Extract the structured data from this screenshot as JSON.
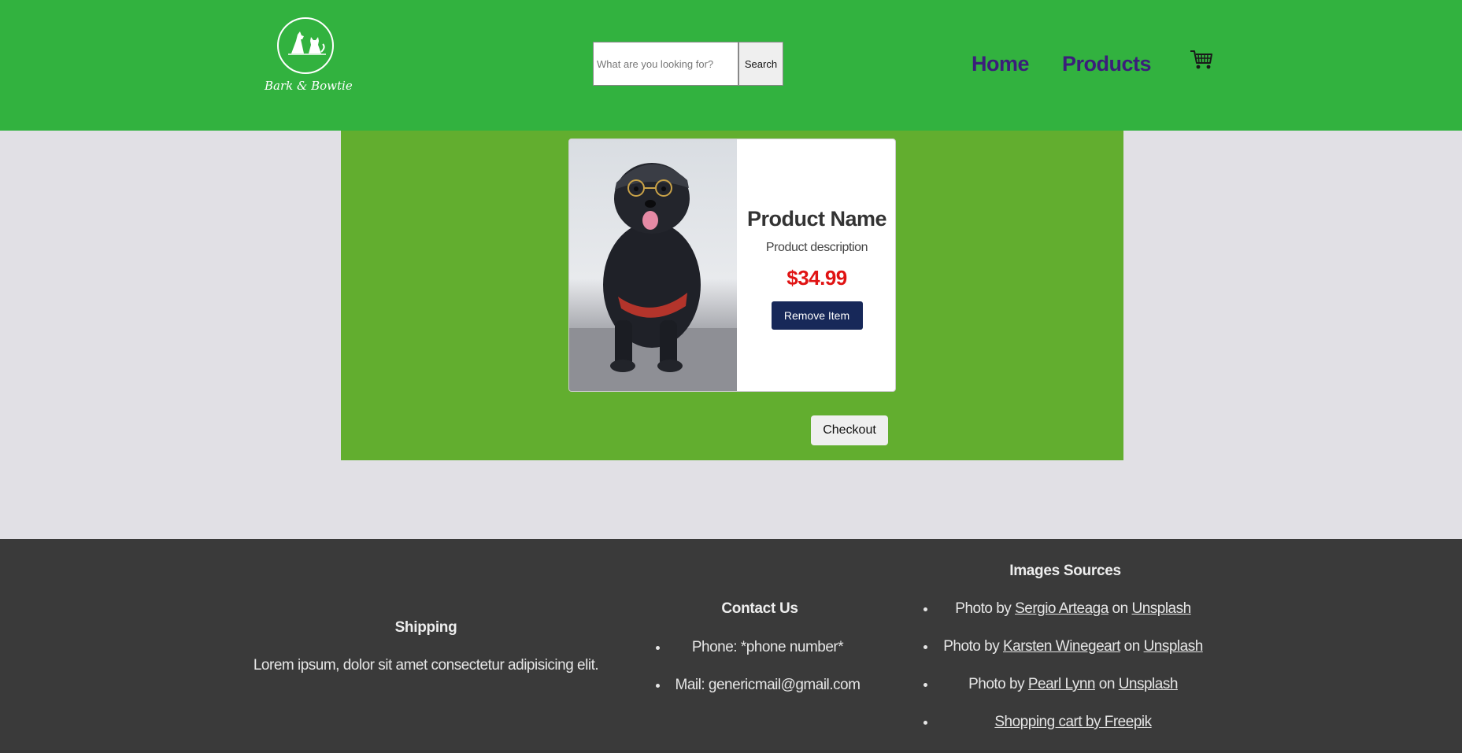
{
  "header": {
    "logo_text": "Bark & Bowtie",
    "search_placeholder": "What are you looking for?",
    "search_button": "Search",
    "nav": [
      {
        "label": "Home"
      },
      {
        "label": "Products"
      }
    ],
    "cart_icon": "shopping-cart-icon"
  },
  "cart": {
    "items": [
      {
        "name": "Product Name",
        "description": "Product description",
        "price": "$34.99",
        "remove_label": "Remove Item",
        "image": "black dog wearing cap and glasses"
      }
    ],
    "checkout_label": "Checkout"
  },
  "footer": {
    "shipping": {
      "title": "Shipping",
      "text": "Lorem ipsum, dolor sit amet consectetur adipisicing elit."
    },
    "contact": {
      "title": "Contact Us",
      "items": [
        "Phone: *phone number*",
        "Mail: genericmail@gmail.com"
      ]
    },
    "images": {
      "title": "Images Sources",
      "credits": [
        {
          "prefix": "Photo by ",
          "author": "Sergio Arteaga",
          "mid": " on ",
          "site": "Unsplash"
        },
        {
          "prefix": "Photo by ",
          "author": "Karsten Winegeart",
          "mid": " on ",
          "site": "Unsplash"
        },
        {
          "prefix": "Photo by ",
          "author": "Pearl Lynn",
          "mid": " on ",
          "site": "Unsplash"
        }
      ],
      "last_link": "Shopping cart by Freepik"
    }
  },
  "colors": {
    "header_bg": "#32b23f",
    "main_bg": "#62ae2f",
    "nav_link": "#3b1e7a",
    "price": "#e01313",
    "remove_button": "#172859",
    "footer_bg": "#3a3a3a"
  }
}
